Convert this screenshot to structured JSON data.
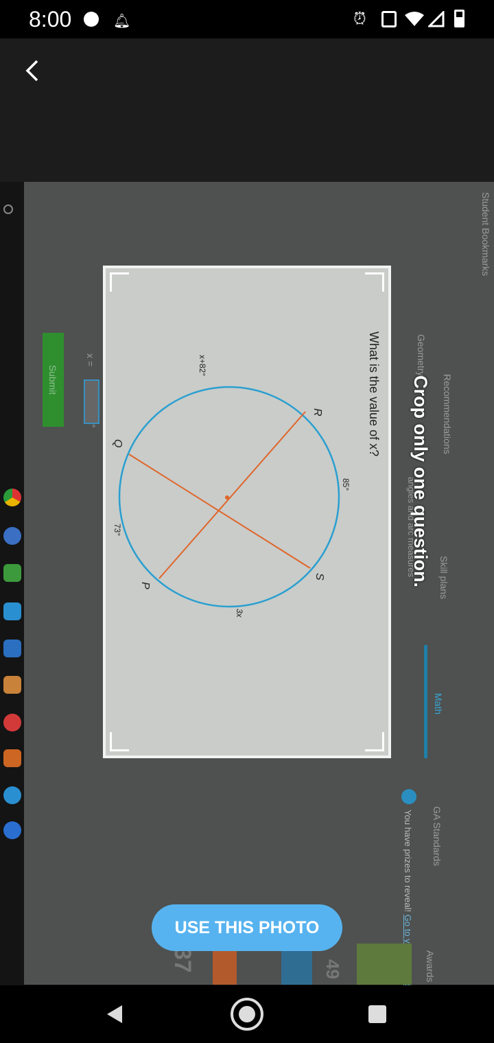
{
  "status_bar": {
    "time": "8:00",
    "left_icons": [
      "dot-icon",
      "notification-bell-icon"
    ],
    "right_icons": [
      "alarm-icon",
      "vibrate-icon",
      "wifi-icon",
      "signal-icon",
      "battery-icon"
    ]
  },
  "toolbar": {
    "back_icon": "back-arrow-icon"
  },
  "overlay": {
    "instruction": "Crop only one question.",
    "use_photo_label": "USE THIS PHOTO"
  },
  "photo": {
    "bookmarks": "Student Bookmarks",
    "tabs": [
      "Recommendations",
      "Skill plans",
      "Math",
      "GA Standards",
      "Awards"
    ],
    "active_tab": "Math",
    "breadcrumb": "Geometry",
    "skill_title": "angles and arc measures",
    "prize_text": "You have prizes to reveal!",
    "prize_link": "Go to your game board",
    "question": "What is the value of x?",
    "answer_label": "x =",
    "answer_value": "",
    "degree_unit": "°",
    "submit_label": "Submit",
    "side_score": "49",
    "side_score2": "37",
    "diagram": {
      "points": {
        "R": "R",
        "S": "S",
        "P": "P",
        "Q": "Q"
      },
      "arcs": {
        "RS": "85°",
        "SP": "3x",
        "PQ": "73°",
        "QR": "x+82°"
      },
      "circle_color": "#2a9fd0",
      "chord_color": "#e0652a"
    }
  },
  "colors": {
    "accent": "#57b3ef",
    "submit": "#2f8f2f"
  }
}
